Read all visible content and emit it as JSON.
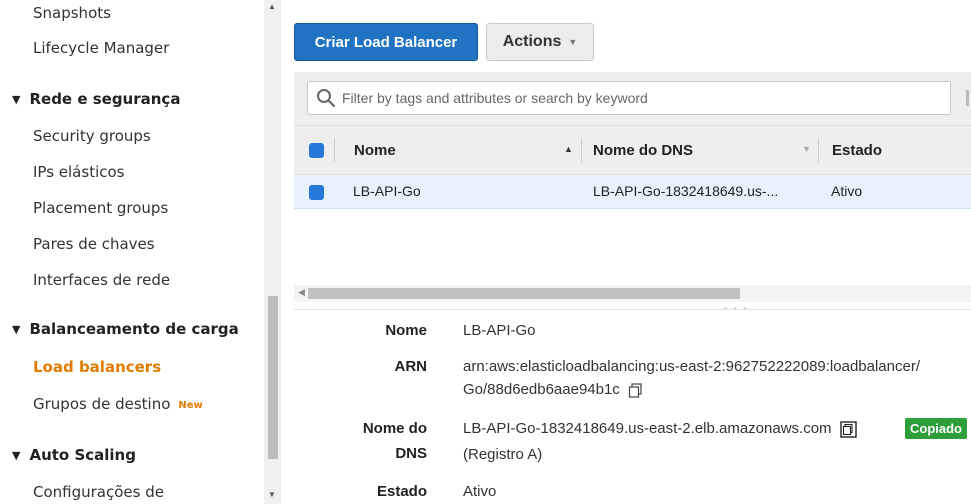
{
  "sidebar": {
    "items": [
      {
        "label": "Snapshots"
      },
      {
        "label": "Lifecycle Manager"
      }
    ],
    "section_network": {
      "label": "Rede e segurança"
    },
    "network_items": [
      {
        "label": "Security groups"
      },
      {
        "label": "IPs elásticos"
      },
      {
        "label": "Placement groups"
      },
      {
        "label": "Pares de chaves"
      },
      {
        "label": "Interfaces de rede"
      }
    ],
    "section_lb": {
      "label": "Balanceamento de carga"
    },
    "lb_items": [
      {
        "label": "Load balancers"
      },
      {
        "label": "Grupos de destino",
        "badge": "New"
      }
    ],
    "section_as": {
      "label": "Auto Scaling"
    },
    "as_items": [
      {
        "label": "Configurações de"
      }
    ]
  },
  "toolbar": {
    "create_label": "Criar Load Balancer",
    "actions_label": "Actions"
  },
  "filter": {
    "placeholder": "Filter by tags and attributes or search by keyword"
  },
  "table": {
    "columns": [
      "Nome",
      "Nome do DNS",
      "Estado"
    ],
    "rows": [
      {
        "nome": "LB-API-Go",
        "dns": "LB-API-Go-1832418649.us-...",
        "estado": "Ativo"
      }
    ]
  },
  "details": {
    "nome_label": "Nome",
    "nome_value": "LB-API-Go",
    "arn_label": "ARN",
    "arn_line1": "arn:aws:elasticloadbalancing:us-east-2:962752222089:loadbalancer/",
    "arn_line2": "Go/88d6edb6aae94b1c",
    "dns_label_1": "Nome do",
    "dns_label_2": "DNS",
    "dns_value": "LB-API-Go-1832418649.us-east-2.elb.amazonaws.com",
    "dns_copied": "Copiado",
    "dns_record": "(Registro A)",
    "estado_label": "Estado",
    "estado_value": "Ativo"
  },
  "colors": {
    "primary_button": "#1f73c2",
    "active_nav": "#e07b00",
    "checkbox": "#2577d8",
    "copied_badge": "#2e9e3a"
  }
}
